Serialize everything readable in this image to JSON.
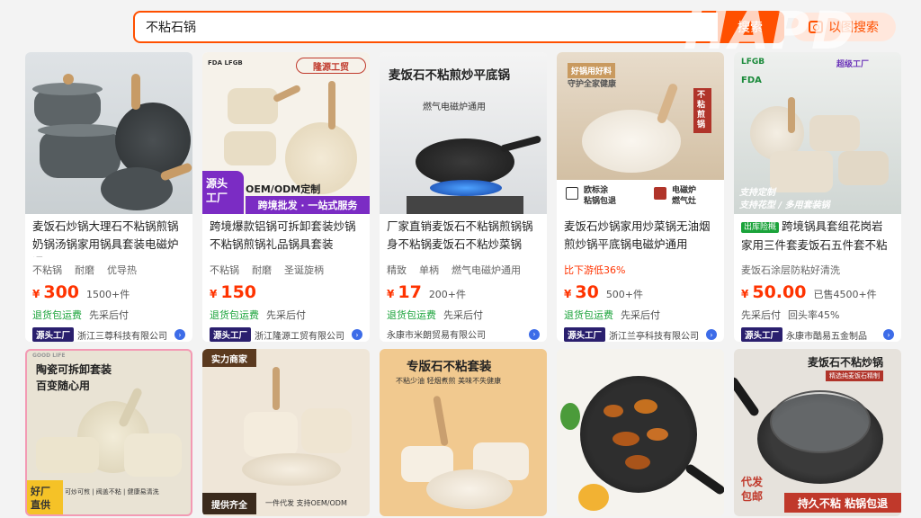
{
  "search": {
    "query": "不粘石锅",
    "button": "搜索",
    "image_search": "以图搜索"
  },
  "watermark": "HAPD",
  "products": [
    {
      "title": "麦饭石炒锅大理石不粘锅煎锅奶锅汤锅家用锅具套装电磁炉通用",
      "tags": [
        "不粘锅",
        "耐磨",
        "优导热"
      ],
      "price": "300",
      "sold": "1500+件",
      "services": [
        "退货包运费",
        "先采后付"
      ],
      "badge": "源头工厂",
      "shop": "浙江三尊科技有限公司",
      "overlay": {}
    },
    {
      "title": "跨境爆款铝锅可拆卸套装炒锅不粘锅煎锅礼品锅具套装",
      "tags": [
        "不粘锅",
        "耐磨",
        "圣诞旋柄"
      ],
      "price": "150",
      "sold": "",
      "services": [
        "退货包运费",
        "先采后付"
      ],
      "badge": "源头工厂",
      "shop": "浙江隆源工贸有限公司",
      "overlay": {
        "brand": "隆源工贸",
        "cert": "FDA LFGB",
        "oem": "OEM/ODM定制",
        "corner1": "源头",
        "corner2": "工厂",
        "line": "跨境批发 · 一站式服务"
      }
    },
    {
      "title": "厂家直销麦饭石不粘锅煎锅锅身不粘锅麦饭石不粘炒菜锅",
      "tags": [
        "精致",
        "单柄",
        "燃气电磁炉通用"
      ],
      "price": "17",
      "sold": "200+件",
      "services": [
        "退货包运费",
        "先采后付"
      ],
      "badge": "",
      "shop": "永康市米朗贸易有限公司",
      "overlay": {
        "headline": "麦饭石不粘煎炒平底锅",
        "sub": "燃气电磁炉通用"
      }
    },
    {
      "title": "麦饭石炒锅家用炒菜锅无油烟煎炒锅平底锅电磁炉通用",
      "tags": [
        "比下游低36%"
      ],
      "price": "30",
      "sold": "500+件",
      "services": [
        "退货包运费",
        "先采后付"
      ],
      "badge": "源头工厂",
      "shop": "浙江兰亭科技有限公司",
      "overlay": {
        "top": "好锅用好料",
        "top2": "守护全家健康",
        "side": "不粘煎锅",
        "f1": "欧标涂",
        "f1b": "粘锅包退",
        "f2": "电磁炉",
        "f2b": "燃气灶"
      }
    },
    {
      "title": "跨境锅具套组花岗岩家用三件套麦饭石五件套不粘锅",
      "hot": "出库险概",
      "tags": [
        "麦饭石涂层防粘好清洗"
      ],
      "price": "50.00",
      "sold": "已售4500+件",
      "services": [
        "先采后付",
        "回头率45%"
      ],
      "badge": "源头工厂",
      "shop": "永康市酷易五金制品",
      "overlay": {
        "cert": "LFGB",
        "fda": "FDA",
        "level": "超级工厂",
        "bottom": "支持定制",
        "bottom2": "支持花型 / 多用套装锅"
      }
    }
  ],
  "row2": [
    {
      "top": "陶瓷可拆卸套装",
      "top2": "百变随心用",
      "corner1": "好厂",
      "corner2": "直供",
      "bottom": "可炒可煎 | 阀盖不粘 | 健康易清洗",
      "brand": "GOOD LIFE"
    },
    {
      "top": "实力商家",
      "bottom1": "提供齐全",
      "bottom2": "一件代发 支持OEM/ODM"
    },
    {
      "top": "专版石不粘套装",
      "top2": "不粘少油 轻烟煮煎 美味不失健康"
    },
    {},
    {
      "top": "麦饭石不粘炒锅",
      "top2": "精选纯麦饭石精制",
      "corner1": "代发",
      "corner2": "包邮",
      "bottom": "持久不粘 粘锅包退"
    }
  ],
  "colors": {
    "accent": "#ff5000",
    "price": "#ff3300",
    "green": "#1aa33a"
  }
}
